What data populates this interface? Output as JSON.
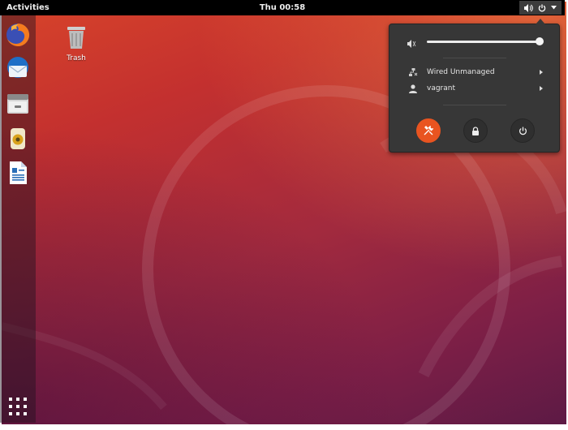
{
  "topbar": {
    "activities_label": "Activities",
    "clock": "Thu 00:58",
    "tray_icons": [
      "volume-icon",
      "power-icon",
      "dropdown-arrow-icon"
    ]
  },
  "dock": {
    "apps": [
      "firefox",
      "thunderbird",
      "files",
      "rhythmbox",
      "libreoffice-writer"
    ],
    "show_apps_icon": "app-grid-icon"
  },
  "desktop": {
    "icons": [
      {
        "label": "Trash",
        "icon": "trash-icon"
      }
    ]
  },
  "status_menu": {
    "volume_level_fraction": 0.97,
    "items": [
      {
        "label": "Wired Unmanaged",
        "icon": "wired-network-icon"
      },
      {
        "label": "vagrant",
        "icon": "user-icon"
      }
    ],
    "buttons": [
      "settings-icon",
      "lock-icon",
      "power-icon"
    ]
  },
  "colors": {
    "accent": "#e95420",
    "panel": "#000000",
    "menu_bg": "#373737"
  }
}
